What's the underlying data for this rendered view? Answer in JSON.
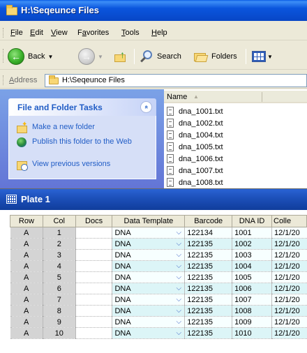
{
  "explorer": {
    "title": "H:\\Seqeunce Files",
    "menu": [
      {
        "label": "File",
        "u": "F",
        "rest": "ile"
      },
      {
        "label": "Edit",
        "u": "E",
        "rest": "dit"
      },
      {
        "label": "View",
        "u": "V",
        "rest": "iew"
      },
      {
        "label": "Favorites",
        "pre": "F",
        "u": "a",
        "rest": "vorites"
      },
      {
        "label": "Tools",
        "u": "T",
        "rest": "ools"
      },
      {
        "label": "Help",
        "u": "H",
        "rest": "elp"
      }
    ],
    "toolbar": {
      "back_label": "Back",
      "search_label": "Search",
      "folders_label": "Folders"
    },
    "address": {
      "label_u": "A",
      "label_rest": "ddress",
      "value": "H:\\Seqeunce Files"
    },
    "tasks": {
      "header": "File and Folder Tasks",
      "collapse_glyph": "»",
      "items": [
        {
          "label": "Make a new folder",
          "icon": "new-folder-icon"
        },
        {
          "label": "Publish this folder to the Web",
          "icon": "globe-icon"
        },
        {
          "label": "View previous versions",
          "icon": "previous-versions-icon"
        }
      ]
    },
    "files": {
      "column_name": "Name",
      "items": [
        "dna_1001.txt",
        "dna_1002.txt",
        "dna_1004.txt",
        "dna_1005.txt",
        "dna_1006.txt",
        "dna_1007.txt",
        "dna_1008.txt"
      ]
    }
  },
  "plate": {
    "title": "Plate 1",
    "columns": [
      "Row",
      "Col",
      "Docs",
      "Data Template",
      "Barcode",
      "DNA ID",
      "Colle"
    ],
    "rows": [
      {
        "row": "A",
        "col": "1",
        "docs": "",
        "template": "DNA",
        "barcode": "122134",
        "dna_id": "1001",
        "collected": "12/1/20"
      },
      {
        "row": "A",
        "col": "2",
        "docs": "",
        "template": "DNA",
        "barcode": "122135",
        "dna_id": "1002",
        "collected": "12/1/20"
      },
      {
        "row": "A",
        "col": "3",
        "docs": "",
        "template": "DNA",
        "barcode": "122135",
        "dna_id": "1003",
        "collected": "12/1/20"
      },
      {
        "row": "A",
        "col": "4",
        "docs": "",
        "template": "DNA",
        "barcode": "122135",
        "dna_id": "1004",
        "collected": "12/1/20"
      },
      {
        "row": "A",
        "col": "5",
        "docs": "",
        "template": "DNA",
        "barcode": "122135",
        "dna_id": "1005",
        "collected": "12/1/20"
      },
      {
        "row": "A",
        "col": "6",
        "docs": "",
        "template": "DNA",
        "barcode": "122135",
        "dna_id": "1006",
        "collected": "12/1/20"
      },
      {
        "row": "A",
        "col": "7",
        "docs": "",
        "template": "DNA",
        "barcode": "122135",
        "dna_id": "1007",
        "collected": "12/1/20"
      },
      {
        "row": "A",
        "col": "8",
        "docs": "",
        "template": "DNA",
        "barcode": "122135",
        "dna_id": "1008",
        "collected": "12/1/20"
      },
      {
        "row": "A",
        "col": "9",
        "docs": "",
        "template": "DNA",
        "barcode": "122135",
        "dna_id": "1009",
        "collected": "12/1/20"
      },
      {
        "row": "A",
        "col": "10",
        "docs": "",
        "template": "DNA",
        "barcode": "122135",
        "dna_id": "1010",
        "collected": "12/1/20"
      }
    ]
  },
  "colors": {
    "xp_titlebar": "#0a55dd",
    "task_link": "#215dc6",
    "row_alt": "#dcf5f7"
  }
}
